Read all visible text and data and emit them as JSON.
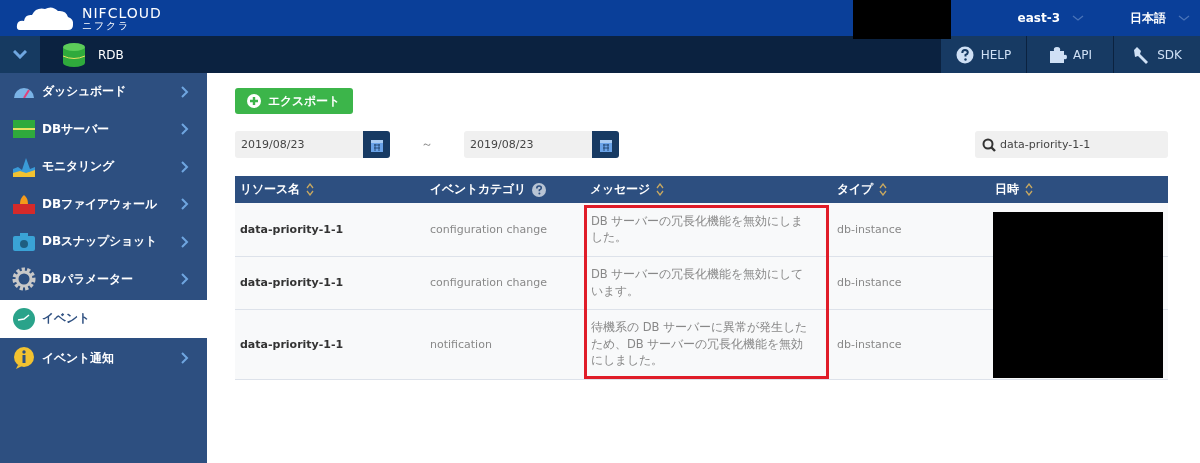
{
  "header": {
    "logo": "NIFCLOUD",
    "logo_sub": "ニフクラ",
    "region": "east-3",
    "language": "日本語"
  },
  "service_bar": {
    "service": "RDB",
    "links": [
      {
        "label": "HELP",
        "kind": "help"
      },
      {
        "label": "API",
        "kind": "api"
      },
      {
        "label": "SDK",
        "kind": "sdk"
      }
    ]
  },
  "sidebar": {
    "items": [
      {
        "label": "ダッシュボード",
        "kind": "dashboard",
        "selected": false
      },
      {
        "label": "DBサーバー",
        "kind": "server",
        "selected": false
      },
      {
        "label": "モニタリング",
        "kind": "monitoring",
        "selected": false
      },
      {
        "label": "DBファイアウォール",
        "kind": "firewall",
        "selected": false
      },
      {
        "label": "DBスナップショット",
        "kind": "snapshot",
        "selected": false
      },
      {
        "label": "DBパラメーター",
        "kind": "parameter",
        "selected": false
      },
      {
        "label": "イベント",
        "kind": "event",
        "selected": true
      },
      {
        "label": "イベント通知",
        "kind": "notify",
        "selected": false
      }
    ]
  },
  "export_button": "エクスポート",
  "date_from": "2019/08/23",
  "date_separator": "～",
  "date_to": "2019/08/23",
  "search": {
    "value": "data-priority-1-1"
  },
  "table": {
    "columns": [
      {
        "label": "リソース名",
        "kind": "sort"
      },
      {
        "label": "イベントカテゴリ",
        "kind": "help"
      },
      {
        "label": "メッセージ",
        "kind": "sort"
      },
      {
        "label": "タイプ",
        "kind": "sort"
      },
      {
        "label": "日時",
        "kind": "sort"
      }
    ],
    "highlight_frame": {
      "kind": "message_column"
    },
    "rows": [
      {
        "resource": "data-priority-1-1",
        "category": "configuration change",
        "message": [
          "DB サーバーの冗長化機能を無効にしま",
          "した。"
        ],
        "type": "db-instance"
      },
      {
        "resource": "data-priority-1-1",
        "category": "configuration change",
        "message": [
          "DB サーバーの冗長化機能を無効にして",
          "います。"
        ],
        "type": "db-instance"
      },
      {
        "resource": "data-priority-1-1",
        "category": "notification",
        "message": [
          "待機系の DB サーバーに異常が発生した",
          "ため、DB サーバーの冗長化機能を無効",
          "にしました。"
        ],
        "type": "db-instance"
      }
    ]
  }
}
